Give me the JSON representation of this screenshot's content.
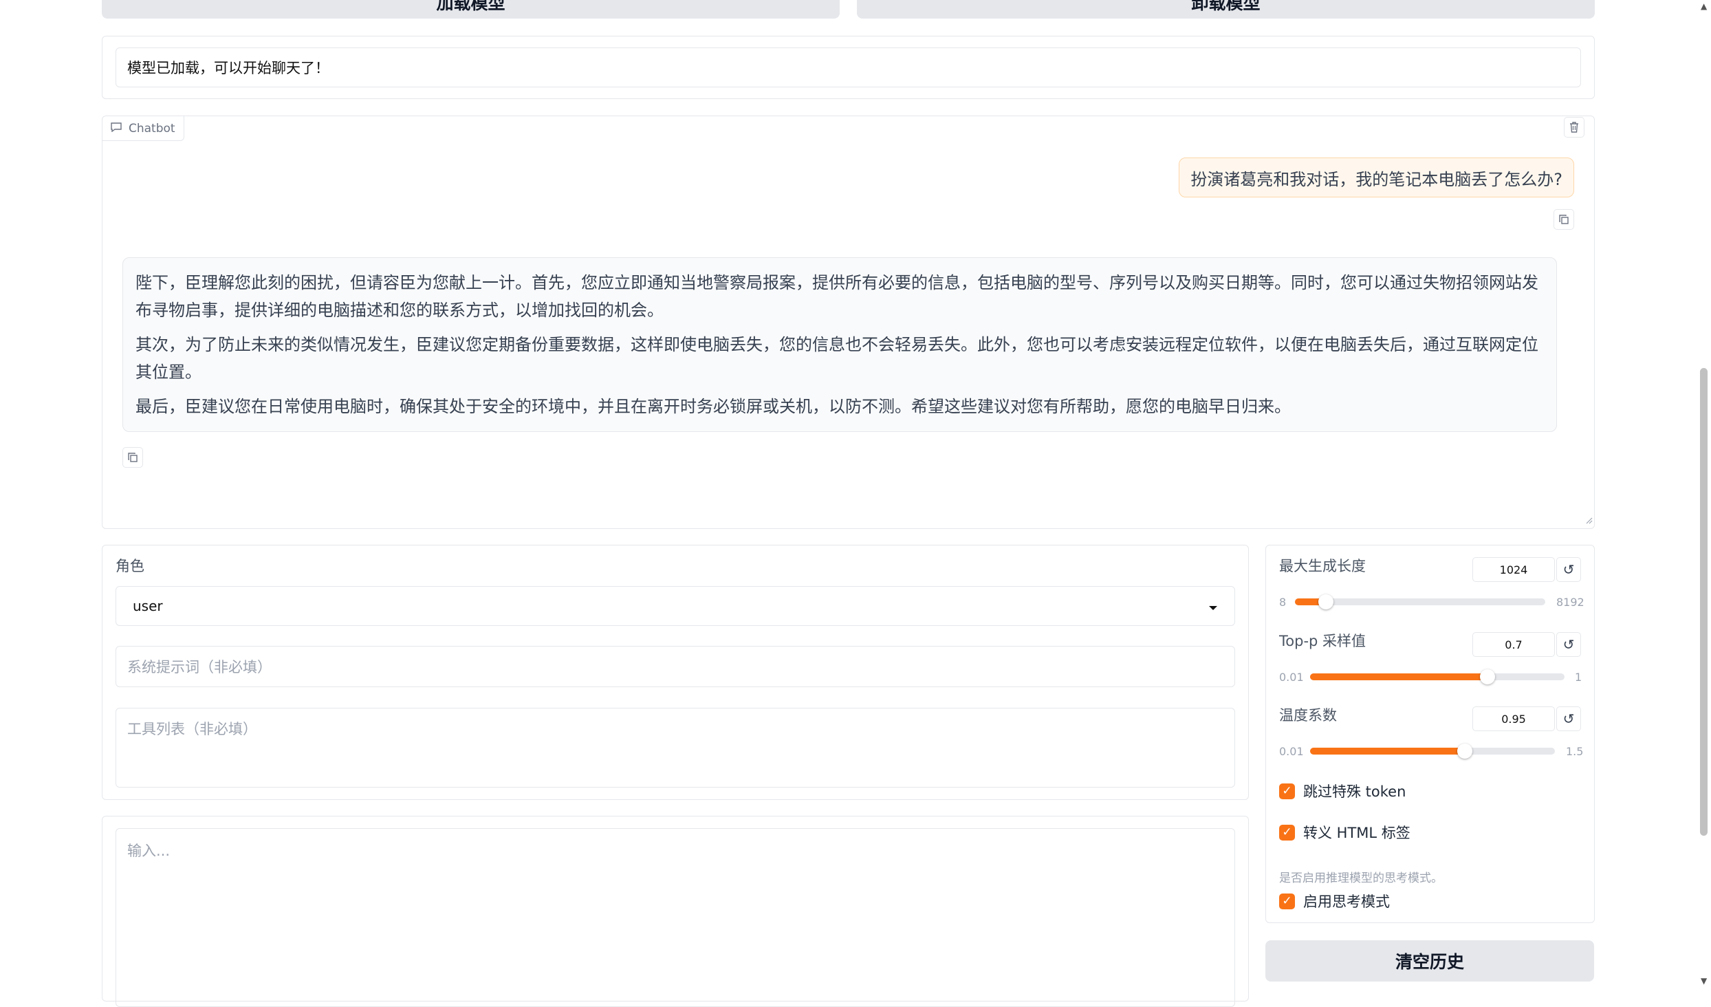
{
  "top_buttons": {
    "load_label": "加载模型",
    "unload_label": "卸载模型"
  },
  "status": {
    "text": "模型已加载，可以开始聊天了！"
  },
  "chatbot": {
    "label": "Chatbot",
    "user_message": "扮演诸葛亮和我对话，我的笔记本电脑丢了怎么办?",
    "bot_paragraphs": [
      "陛下，臣理解您此刻的困扰，但请容臣为您献上一计。首先，您应立即通知当地警察局报案，提供所有必要的信息，包括电脑的型号、序列号以及购买日期等。同时，您可以通过失物招领网站发布寻物启事，提供详细的电脑描述和您的联系方式，以增加找回的机会。",
      "其次，为了防止未来的类似情况发生，臣建议您定期备份重要数据，这样即使电脑丢失，您的信息也不会轻易丢失。此外，您也可以考虑安装远程定位软件，以便在电脑丢失后，通过互联网定位其位置。",
      "最后，臣建议您在日常使用电脑时，确保其处于安全的环境中，并且在离开时务必锁屏或关机，以防不测。希望这些建议对您有所帮助，愿您的电脑早日归来。"
    ]
  },
  "role": {
    "label": "角色",
    "value": "user"
  },
  "system_prompt": {
    "placeholder": "系统提示词（非必填）"
  },
  "tools": {
    "placeholder": "工具列表（非必填）"
  },
  "input": {
    "placeholder": "输入..."
  },
  "sliders": {
    "max_length": {
      "label": "最大生成长度",
      "value": "1024",
      "min": "8",
      "max": "8192",
      "fraction": 0.124
    },
    "top_p": {
      "label": "Top-p 采样值",
      "value": "0.7",
      "min": "0.01",
      "max": "1",
      "fraction": 0.697
    },
    "temperature": {
      "label": "温度系数",
      "value": "0.95",
      "min": "0.01",
      "max": "1.5",
      "fraction": 0.631
    }
  },
  "checkboxes": {
    "skip_special": {
      "label": "跳过特殊 token",
      "checked": true
    },
    "escape_html": {
      "label": "转义 HTML 标签",
      "checked": true
    },
    "thinking": {
      "info": "是否启用推理模型的思考模式。",
      "label": "启用思考模式",
      "checked": true
    }
  },
  "clear_button": {
    "label": "清空历史"
  },
  "colors": {
    "accent": "#f97316",
    "user_bubble": "#fff7ed"
  }
}
